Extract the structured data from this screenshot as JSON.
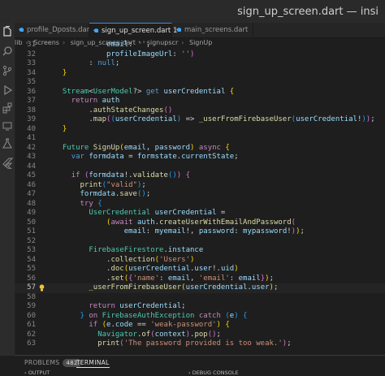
{
  "window": {
    "title": "sign_up_screen.dart — insi"
  },
  "tabs": [
    {
      "label": "profile_Dposts.dart",
      "active": false
    },
    {
      "label": "sign_up_screen.dart 1",
      "active": true
    },
    {
      "label": "main_screens.dart",
      "active": false
    }
  ],
  "breadcrumb": [
    "lib",
    "Screens",
    "sign_up_screen.dart",
    "signupscr",
    "SignUp"
  ],
  "activity_icons": [
    "explorer-icon",
    "search-icon",
    "source-control-icon",
    "run-debug-icon",
    "extensions-icon",
    "remote-icon",
    "testing-icon",
    "flutter-icon"
  ],
  "colors": {
    "keyword": "#c586c0",
    "storage": "#569cd6",
    "type": "#4ec9b0",
    "function": "#dcdcaa",
    "string": "#ce9178",
    "variable": "#9cdcfe",
    "accent": "#3d8ee0"
  },
  "editor": {
    "current_line": 57,
    "lightbulb_line": 57,
    "lines": [
      {
        "n": 31,
        "tokens": [
          [
            "pun",
            "            "
          ],
          [
            "var",
            "email"
          ],
          [
            "pun",
            ": "
          ],
          [
            "str",
            "''"
          ],
          [
            "pun",
            ","
          ]
        ]
      },
      {
        "n": 32,
        "tokens": [
          [
            "pun",
            "            "
          ],
          [
            "var",
            "profileImageUrl"
          ],
          [
            "pun",
            ": "
          ],
          [
            "str",
            "''"
          ],
          [
            "br2",
            ")"
          ]
        ]
      },
      {
        "n": 33,
        "tokens": [
          [
            "pun",
            "        "
          ],
          [
            "pun",
            ": "
          ],
          [
            "kb",
            "null"
          ],
          [
            "pun",
            ";"
          ]
        ]
      },
      {
        "n": 34,
        "tokens": [
          [
            "br1",
            "  }"
          ]
        ]
      },
      {
        "n": 35,
        "tokens": []
      },
      {
        "n": 36,
        "tokens": [
          [
            "pun",
            "  "
          ],
          [
            "ty",
            "Stream"
          ],
          [
            "pun",
            "<"
          ],
          [
            "ty",
            "UserModel"
          ],
          [
            "pun",
            "?> "
          ],
          [
            "kb",
            "get"
          ],
          [
            "pun",
            " "
          ],
          [
            "var",
            "userCredential"
          ],
          [
            "pun",
            " "
          ],
          [
            "br1",
            "{"
          ]
        ]
      },
      {
        "n": 37,
        "tokens": [
          [
            "pun",
            "    "
          ],
          [
            "kw",
            "return"
          ],
          [
            "pun",
            " "
          ],
          [
            "var",
            "auth"
          ]
        ]
      },
      {
        "n": 38,
        "tokens": [
          [
            "pun",
            "        ."
          ],
          [
            "fn",
            "authStateChanges"
          ],
          [
            "br2",
            "()"
          ]
        ]
      },
      {
        "n": 39,
        "tokens": [
          [
            "pun",
            "        ."
          ],
          [
            "fn",
            "map"
          ],
          [
            "br2",
            "("
          ],
          [
            "br3",
            "("
          ],
          [
            "var",
            "userCredential"
          ],
          [
            "br3",
            ")"
          ],
          [
            "pun",
            " => "
          ],
          [
            "fn",
            "_userFromFirebaseUser"
          ],
          [
            "br3",
            "("
          ],
          [
            "var",
            "userCredential"
          ],
          [
            "pun",
            "!"
          ],
          [
            "br3",
            ")"
          ],
          [
            "br2",
            ")"
          ],
          [
            "pun",
            ";"
          ]
        ]
      },
      {
        "n": 40,
        "tokens": [
          [
            "br1",
            "  }"
          ]
        ]
      },
      {
        "n": 41,
        "tokens": []
      },
      {
        "n": 42,
        "tokens": [
          [
            "pun",
            "  "
          ],
          [
            "ty",
            "Future"
          ],
          [
            "pun",
            " "
          ],
          [
            "fn",
            "SignUp"
          ],
          [
            "br1",
            "("
          ],
          [
            "var",
            "email"
          ],
          [
            "pun",
            ", "
          ],
          [
            "var",
            "password"
          ],
          [
            "br1",
            ")"
          ],
          [
            "pun",
            " "
          ],
          [
            "kw",
            "async"
          ],
          [
            "pun",
            " "
          ],
          [
            "br1",
            "{"
          ]
        ]
      },
      {
        "n": 43,
        "tokens": [
          [
            "pun",
            "    "
          ],
          [
            "kb",
            "var"
          ],
          [
            "pun",
            " "
          ],
          [
            "var",
            "formdata"
          ],
          [
            "pun",
            " = "
          ],
          [
            "var",
            "formstate"
          ],
          [
            "pun",
            "."
          ],
          [
            "var",
            "currentState"
          ],
          [
            "pun",
            ";"
          ]
        ]
      },
      {
        "n": 44,
        "tokens": []
      },
      {
        "n": 45,
        "tokens": [
          [
            "pun",
            "    "
          ],
          [
            "kw",
            "if"
          ],
          [
            "pun",
            " "
          ],
          [
            "br2",
            "("
          ],
          [
            "var",
            "formdata"
          ],
          [
            "pun",
            "!."
          ],
          [
            "fn",
            "validate"
          ],
          [
            "br3",
            "()"
          ],
          [
            "br2",
            ")"
          ],
          [
            "pun",
            " "
          ],
          [
            "br2",
            "{"
          ]
        ]
      },
      {
        "n": 46,
        "tokens": [
          [
            "pun",
            "      "
          ],
          [
            "fn",
            "print"
          ],
          [
            "br3",
            "("
          ],
          [
            "str",
            "\"valid\""
          ],
          [
            "br3",
            ")"
          ],
          [
            "pun",
            ";"
          ]
        ]
      },
      {
        "n": 47,
        "tokens": [
          [
            "pun",
            "      "
          ],
          [
            "var",
            "formdata"
          ],
          [
            "pun",
            "."
          ],
          [
            "fn",
            "save"
          ],
          [
            "br3",
            "()"
          ],
          [
            "pun",
            ";"
          ]
        ]
      },
      {
        "n": 48,
        "tokens": [
          [
            "pun",
            "      "
          ],
          [
            "kw",
            "try"
          ],
          [
            "pun",
            " "
          ],
          [
            "br3",
            "{"
          ]
        ]
      },
      {
        "n": 49,
        "tokens": [
          [
            "pun",
            "        "
          ],
          [
            "ty",
            "UserCredential"
          ],
          [
            "pun",
            " "
          ],
          [
            "var",
            "userCredential"
          ],
          [
            "pun",
            " ="
          ]
        ]
      },
      {
        "n": 50,
        "tokens": [
          [
            "pun",
            "            "
          ],
          [
            "br1",
            "("
          ],
          [
            "kw",
            "await"
          ],
          [
            "pun",
            " "
          ],
          [
            "var",
            "auth"
          ],
          [
            "pun",
            "."
          ],
          [
            "fn",
            "createUserWithEmailAndPassword"
          ],
          [
            "br2",
            "("
          ]
        ]
      },
      {
        "n": 51,
        "tokens": [
          [
            "pun",
            "                "
          ],
          [
            "var",
            "email"
          ],
          [
            "pun",
            ": "
          ],
          [
            "var",
            "myemail"
          ],
          [
            "pun",
            "!, "
          ],
          [
            "var",
            "password"
          ],
          [
            "pun",
            ": "
          ],
          [
            "var",
            "mypassword"
          ],
          [
            "pun",
            "!"
          ],
          [
            "br2",
            ")"
          ],
          [
            "br1",
            ")"
          ],
          [
            "pun",
            ";"
          ]
        ]
      },
      {
        "n": 52,
        "tokens": []
      },
      {
        "n": 53,
        "tokens": [
          [
            "pun",
            "        "
          ],
          [
            "ty",
            "FirebaseFirestore"
          ],
          [
            "pun",
            "."
          ],
          [
            "var",
            "instance"
          ]
        ]
      },
      {
        "n": 54,
        "tokens": [
          [
            "pun",
            "            ."
          ],
          [
            "fn",
            "collection"
          ],
          [
            "br1",
            "("
          ],
          [
            "str",
            "'Users'"
          ],
          [
            "br1",
            ")"
          ]
        ]
      },
      {
        "n": 55,
        "tokens": [
          [
            "pun",
            "            ."
          ],
          [
            "fn",
            "doc"
          ],
          [
            "br1",
            "("
          ],
          [
            "var",
            "userCredential"
          ],
          [
            "pun",
            "."
          ],
          [
            "var",
            "user"
          ],
          [
            "pun",
            "!."
          ],
          [
            "var",
            "uid"
          ],
          [
            "br1",
            ")"
          ]
        ]
      },
      {
        "n": 56,
        "tokens": [
          [
            "pun",
            "            ."
          ],
          [
            "fn",
            "set"
          ],
          [
            "br1",
            "("
          ],
          [
            "br2",
            "{"
          ],
          [
            "str",
            "'name'"
          ],
          [
            "pun",
            ": "
          ],
          [
            "var",
            "email"
          ],
          [
            "pun",
            ", "
          ],
          [
            "str",
            "'email'"
          ],
          [
            "pun",
            ": "
          ],
          [
            "var",
            "email"
          ],
          [
            "br2",
            "}"
          ],
          [
            "br1",
            ")"
          ],
          [
            "pun",
            ";"
          ]
        ]
      },
      {
        "n": 57,
        "tokens": [
          [
            "pun",
            "        "
          ],
          [
            "fn",
            "_userFromFirebaseUser"
          ],
          [
            "br1",
            "("
          ],
          [
            "var",
            "userCredential"
          ],
          [
            "pun",
            "."
          ],
          [
            "var",
            "user"
          ],
          [
            "br1",
            ")"
          ],
          [
            "pun",
            ";"
          ]
        ]
      },
      {
        "n": 58,
        "tokens": []
      },
      {
        "n": 59,
        "tokens": [
          [
            "pun",
            "        "
          ],
          [
            "kw",
            "return"
          ],
          [
            "pun",
            " "
          ],
          [
            "var",
            "userCredential"
          ],
          [
            "pun",
            ";"
          ]
        ]
      },
      {
        "n": 60,
        "tokens": [
          [
            "pun",
            "      "
          ],
          [
            "br3",
            "}"
          ],
          [
            "pun",
            " "
          ],
          [
            "kw",
            "on"
          ],
          [
            "pun",
            " "
          ],
          [
            "ty",
            "FirebaseAuthException"
          ],
          [
            "pun",
            " "
          ],
          [
            "kw",
            "catch"
          ],
          [
            "pun",
            " "
          ],
          [
            "br3",
            "("
          ],
          [
            "var",
            "e"
          ],
          [
            "br3",
            ")"
          ],
          [
            "pun",
            " "
          ],
          [
            "br3",
            "{"
          ]
        ]
      },
      {
        "n": 61,
        "tokens": [
          [
            "pun",
            "        "
          ],
          [
            "kw",
            "if"
          ],
          [
            "pun",
            " "
          ],
          [
            "br1",
            "("
          ],
          [
            "var",
            "e"
          ],
          [
            "pun",
            "."
          ],
          [
            "var",
            "code"
          ],
          [
            "pun",
            " == "
          ],
          [
            "str",
            "'weak-password'"
          ],
          [
            "br1",
            ")"
          ],
          [
            "pun",
            " "
          ],
          [
            "br1",
            "{"
          ]
        ]
      },
      {
        "n": 62,
        "tokens": [
          [
            "pun",
            "          "
          ],
          [
            "ty",
            "Navigator"
          ],
          [
            "pun",
            "."
          ],
          [
            "fn",
            "of"
          ],
          [
            "br2",
            "("
          ],
          [
            "var",
            "context"
          ],
          [
            "br2",
            ")"
          ],
          [
            "pun",
            "."
          ],
          [
            "fn",
            "pop"
          ],
          [
            "br2",
            "()"
          ],
          [
            "pun",
            ";"
          ]
        ]
      },
      {
        "n": 63,
        "tokens": [
          [
            "pun",
            "          "
          ],
          [
            "fn",
            "print"
          ],
          [
            "br2",
            "("
          ],
          [
            "str",
            "'The password provided is too weak.'"
          ],
          [
            "br2",
            ")"
          ],
          [
            "pun",
            ";"
          ]
        ]
      }
    ]
  },
  "panel": {
    "tabs": [
      {
        "label": "PROBLEMS",
        "badge": "482",
        "active": false
      },
      {
        "label": "TERMINAL",
        "active": true
      }
    ],
    "subpanels": [
      "OUTPUT",
      "DEBUG CONSOLE"
    ]
  }
}
